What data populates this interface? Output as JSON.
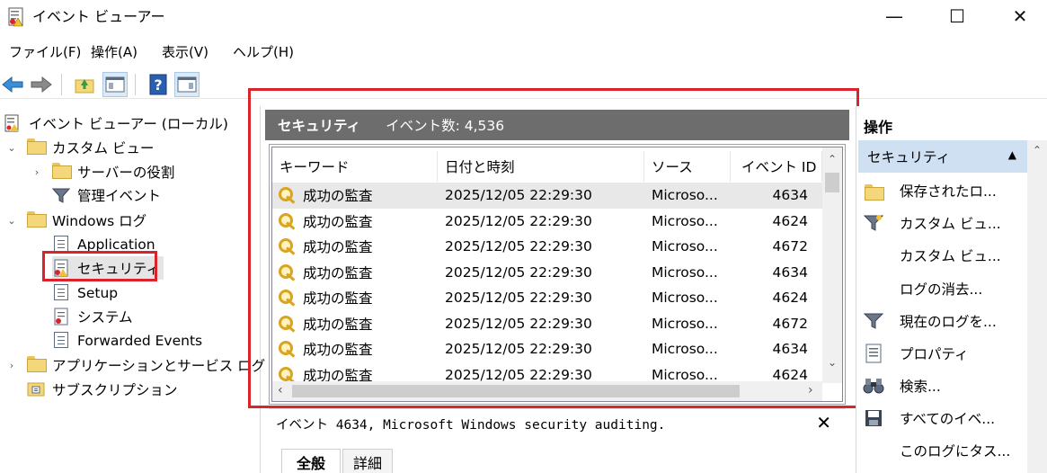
{
  "window": {
    "title": "イベント ビューアー",
    "minimize": "—",
    "maximize": "☐",
    "close": "✕"
  },
  "menu": [
    "ファイル(F)",
    "操作(A)",
    "表示(V)",
    "ヘルプ(H)"
  ],
  "tree": {
    "root": "イベント ビューアー (ローカル)",
    "custom_views": "カスタム ビュー",
    "server_roles": "サーバーの役割",
    "admin_events": "管理イベント",
    "windows_logs": "Windows ログ",
    "application": "Application",
    "security": "セキュリティ",
    "setup": "Setup",
    "system": "システム",
    "forwarded": "Forwarded Events",
    "apps_services": "アプリケーションとサービス ログ",
    "subscriptions": "サブスクリプション"
  },
  "center": {
    "log_name": "セキュリティ",
    "event_count_label": "イベント数: 4,536",
    "columns": [
      "キーワード",
      "日付と時刻",
      "ソース",
      "イベント ID"
    ],
    "rows": [
      {
        "keyword": "成功の監査",
        "datetime": "2025/12/05 22:29:30",
        "source": "Microso...",
        "id": "4634"
      },
      {
        "keyword": "成功の監査",
        "datetime": "2025/12/05 22:29:30",
        "source": "Microso...",
        "id": "4624"
      },
      {
        "keyword": "成功の監査",
        "datetime": "2025/12/05 22:29:30",
        "source": "Microso...",
        "id": "4672"
      },
      {
        "keyword": "成功の監査",
        "datetime": "2025/12/05 22:29:30",
        "source": "Microso...",
        "id": "4634"
      },
      {
        "keyword": "成功の監査",
        "datetime": "2025/12/05 22:29:30",
        "source": "Microso...",
        "id": "4624"
      },
      {
        "keyword": "成功の監査",
        "datetime": "2025/12/05 22:29:30",
        "source": "Microso...",
        "id": "4672"
      },
      {
        "keyword": "成功の監査",
        "datetime": "2025/12/05 22:29:30",
        "source": "Microso...",
        "id": "4634"
      },
      {
        "keyword": "成功の監査",
        "datetime": "2025/12/05 22:29:30",
        "source": "Microso...",
        "id": "4624"
      }
    ],
    "detail_title": "イベント 4634, Microsoft Windows security auditing.",
    "detail_close": "✕",
    "tabs": [
      "全般",
      "詳細"
    ]
  },
  "actions": {
    "title": "操作",
    "section": "セキュリティ",
    "items": [
      {
        "label": "保存されたロ...",
        "icon": "folder-open-icon"
      },
      {
        "label": "カスタム ビュ...",
        "icon": "filter-icon"
      },
      {
        "label": "カスタム ビュ...",
        "icon": ""
      },
      {
        "label": "ログの消去...",
        "icon": ""
      },
      {
        "label": "現在のログを...",
        "icon": "filter-icon"
      },
      {
        "label": "プロパティ",
        "icon": "properties-icon"
      },
      {
        "label": "検索...",
        "icon": "binoculars-icon"
      },
      {
        "label": "すべてのイベ...",
        "icon": "save-icon"
      },
      {
        "label": "このログにタス...",
        "icon": ""
      }
    ]
  },
  "colors": {
    "header_bg": "#6d6d6d",
    "section_bg": "#cfe0f3",
    "highlight_red": "#d9242b"
  }
}
